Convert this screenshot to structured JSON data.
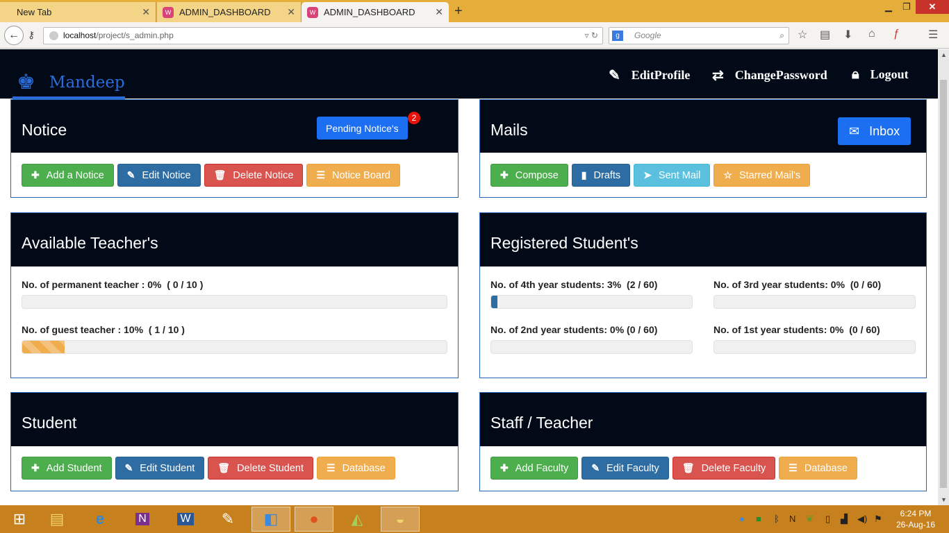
{
  "browser": {
    "tabs": [
      {
        "label": "New Tab"
      },
      {
        "label": "ADMIN_DASHBOARD"
      },
      {
        "label": "ADMIN_DASHBOARD"
      }
    ],
    "url_host": "localhost",
    "url_path": "/project/s_admin.php",
    "search_placeholder": "Google"
  },
  "header": {
    "brand": "Mandeep",
    "links": {
      "edit_profile": "EditProfile",
      "change_password": "ChangePassword",
      "logout": "Logout"
    }
  },
  "notice": {
    "title": "Notice",
    "pending_label": "Pending Notice's",
    "pending_count": "2",
    "buttons": {
      "add": "Add a Notice",
      "edit": "Edit Notice",
      "delete": "Delete Notice",
      "board": "Notice Board"
    }
  },
  "mails": {
    "title": "Mails",
    "inbox_label": "Inbox",
    "buttons": {
      "compose": "Compose",
      "drafts": "Drafts",
      "sent": "Sent Mail",
      "starred": "Starred Mail's"
    }
  },
  "teachers": {
    "title": "Available Teacher's",
    "permanent_label": "No. of permanent teacher : 0%  ( 0 / 10 )",
    "permanent_fraction": 0.0,
    "guest_label": "No. of guest teacher : 10%  ( 1 / 10 )",
    "guest_fraction": 0.1
  },
  "students": {
    "title": "Registered Student's",
    "y4_label": "No. of 4th year students: 3%  (2 / 60)",
    "y4_fraction": 0.03,
    "y3_label": "No. of 3rd year students: 0%  (0 / 60)",
    "y3_fraction": 0.0,
    "y2_label": "No. of 2nd year students: 0% (0 / 60)",
    "y2_fraction": 0.0,
    "y1_label": "No. of 1st year students: 0%  (0 / 60)",
    "y1_fraction": 0.0
  },
  "student_panel": {
    "title": "Student",
    "buttons": {
      "add": "Add Student",
      "edit": "Edit Student",
      "delete": "Delete Student",
      "database": "Database"
    }
  },
  "staff_panel": {
    "title": "Staff / Teacher",
    "buttons": {
      "add": "Add Faculty",
      "edit": "Edit Faculty",
      "delete": "Delete Faculty",
      "database": "Database"
    }
  },
  "taskbar": {
    "time": "6:24 PM",
    "date": "26-Aug-16"
  },
  "colors": {
    "header_bg": "#020a18",
    "brand": "#2a6cd9",
    "panel_border": "#2563b5",
    "success": "#4cae4c",
    "primary": "#2e6da4",
    "danger": "#d9534f",
    "warning": "#f0ad4e",
    "info": "#5bc0de"
  }
}
